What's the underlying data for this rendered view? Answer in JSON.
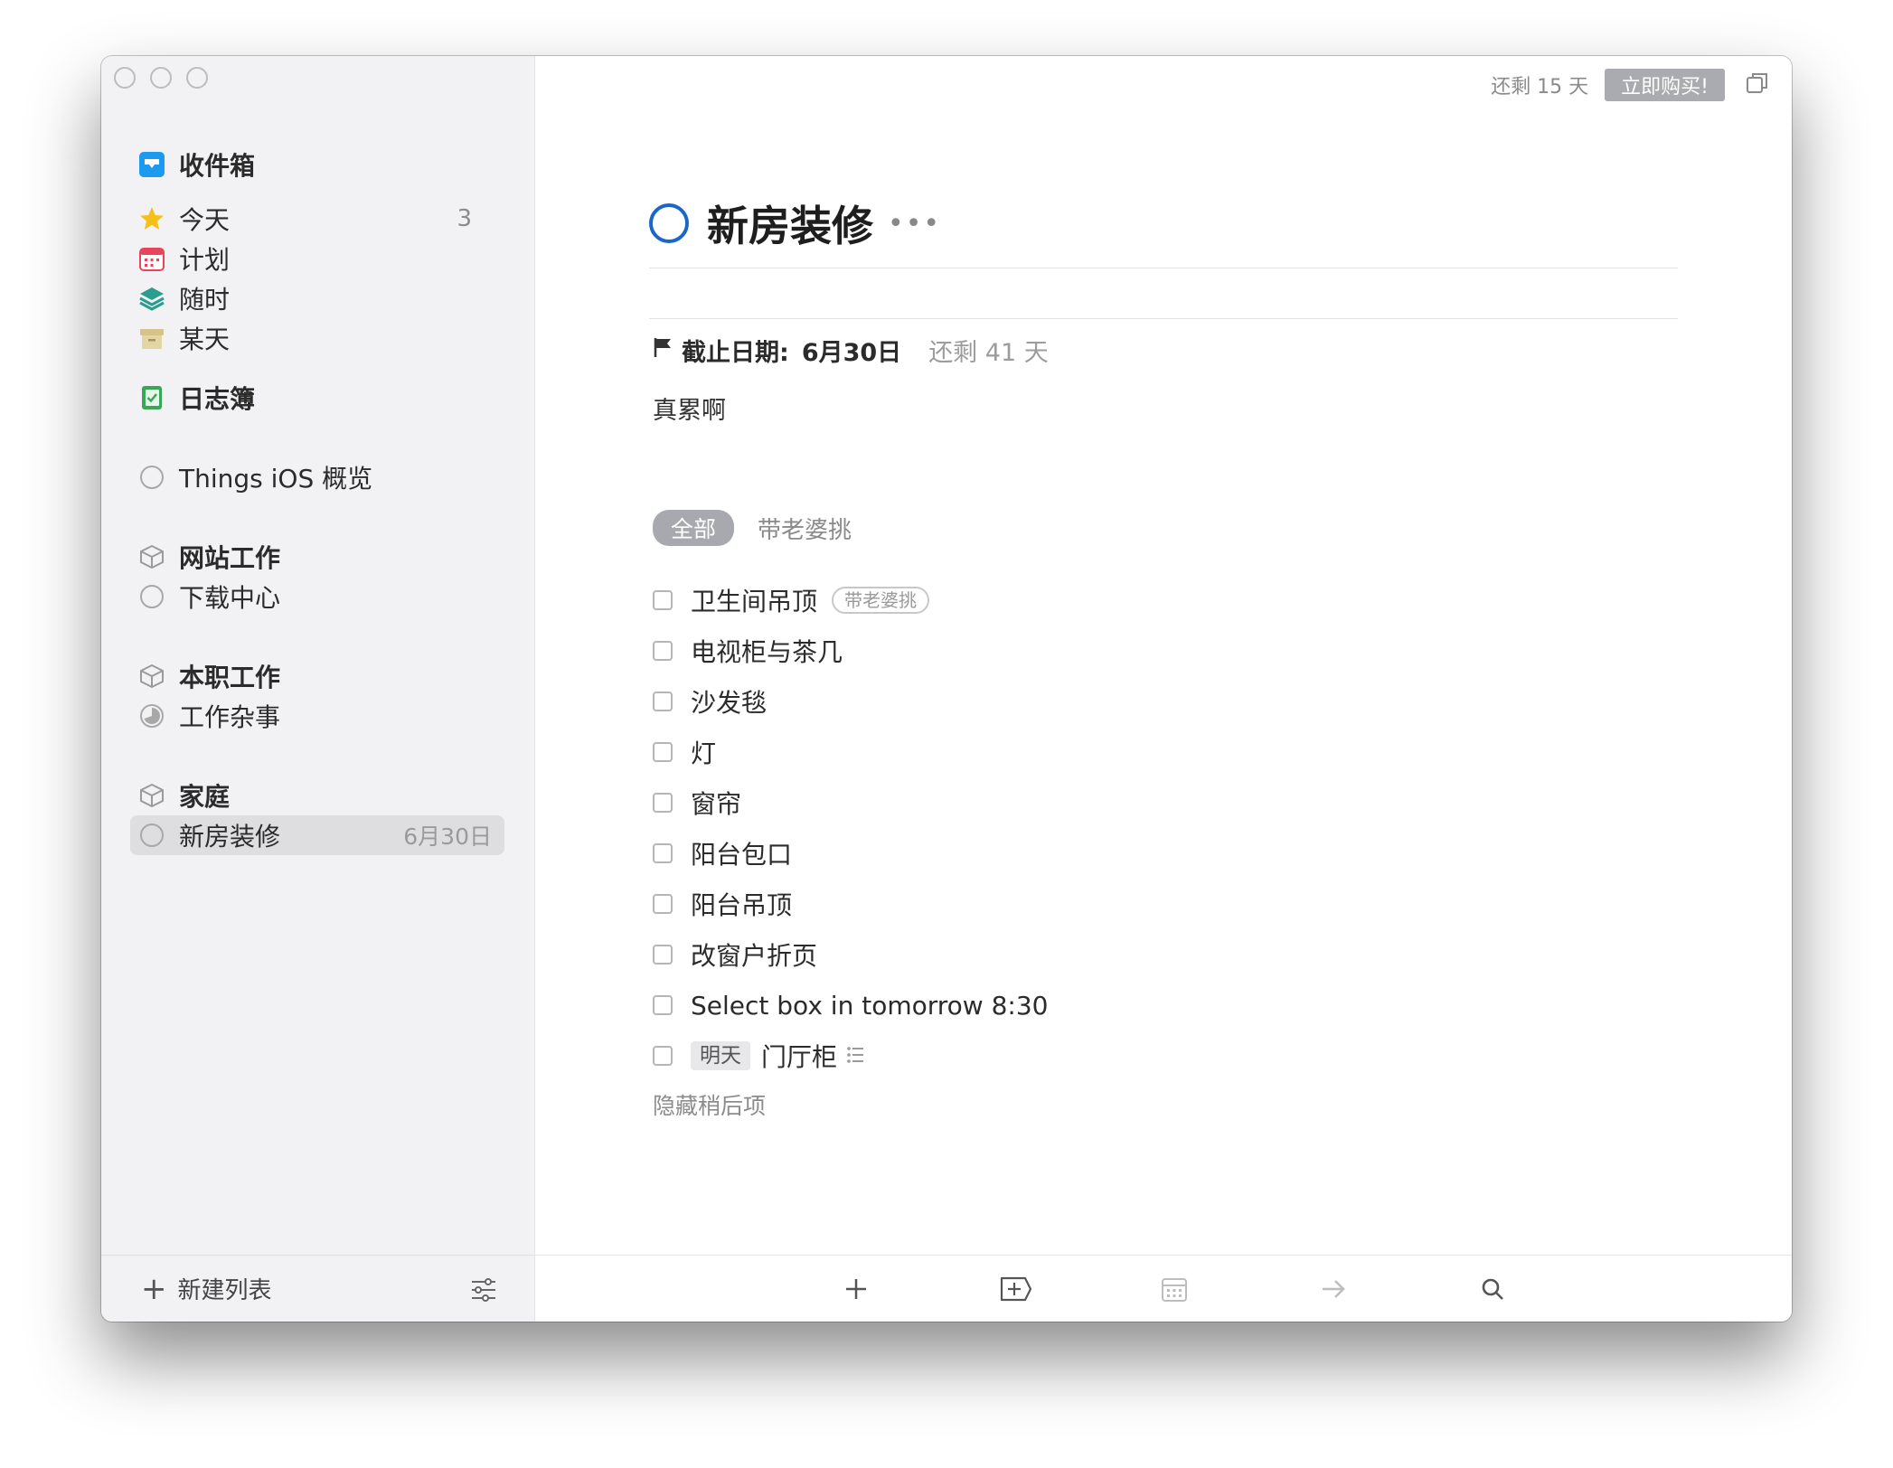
{
  "window": {
    "trial_text": "还剩 15 天",
    "buy_button": "立即购买!"
  },
  "sidebar": {
    "inbox": "收件箱",
    "today": {
      "label": "今天",
      "count": "3"
    },
    "upcoming": "计划",
    "anytime": "随时",
    "someday": "某天",
    "logbook": "日志簿",
    "project_overview": "Things iOS 概览",
    "areas": [
      {
        "label": "网站工作",
        "project": "下载中心"
      },
      {
        "label": "本职工作",
        "project": "工作杂事"
      },
      {
        "label": "家庭",
        "project": "新房装修",
        "project_date": "6月30日"
      }
    ],
    "new_list": "新建列表"
  },
  "project": {
    "title": "新房装修",
    "deadline_label": "截止日期:",
    "deadline_value": "6月30日",
    "deadline_remaining": "还剩 41 天",
    "notes": "真累啊",
    "filters": {
      "all": "全部",
      "tag": "带老婆挑"
    },
    "tasks": [
      {
        "title": "卫生间吊顶",
        "tag": "带老婆挑"
      },
      {
        "title": "电视柜与茶几"
      },
      {
        "title": "沙发毯"
      },
      {
        "title": "灯"
      },
      {
        "title": "窗帘"
      },
      {
        "title": "阳台包口"
      },
      {
        "title": "阳台吊顶"
      },
      {
        "title": "改窗户折页"
      },
      {
        "title": "Select box in tomorrow 8:30"
      },
      {
        "title": "门厅柜",
        "when": "明天"
      }
    ],
    "hide_later": "隐藏稍后项"
  },
  "colors": {
    "accent": "#1b67c9",
    "today_star": "#f6c01b",
    "upcoming_red": "#e8455d",
    "anytime_teal": "#2a9d8f",
    "someday_tan": "#d6c38a",
    "logbook_green": "#3aa757",
    "inbox_blue": "#1b9af0"
  },
  "icons": [
    "inbox-icon",
    "star-icon",
    "calendar-icon",
    "layers-icon",
    "archive-box-icon",
    "logbook-icon",
    "area-box-icon",
    "progress-circle-icon",
    "flag-icon",
    "checklist-icon",
    "plus-icon",
    "add-heading-icon",
    "calendar-toolbar-icon",
    "arrow-right-icon",
    "search-icon",
    "settings-sliders-icon",
    "window-copy-icon"
  ]
}
